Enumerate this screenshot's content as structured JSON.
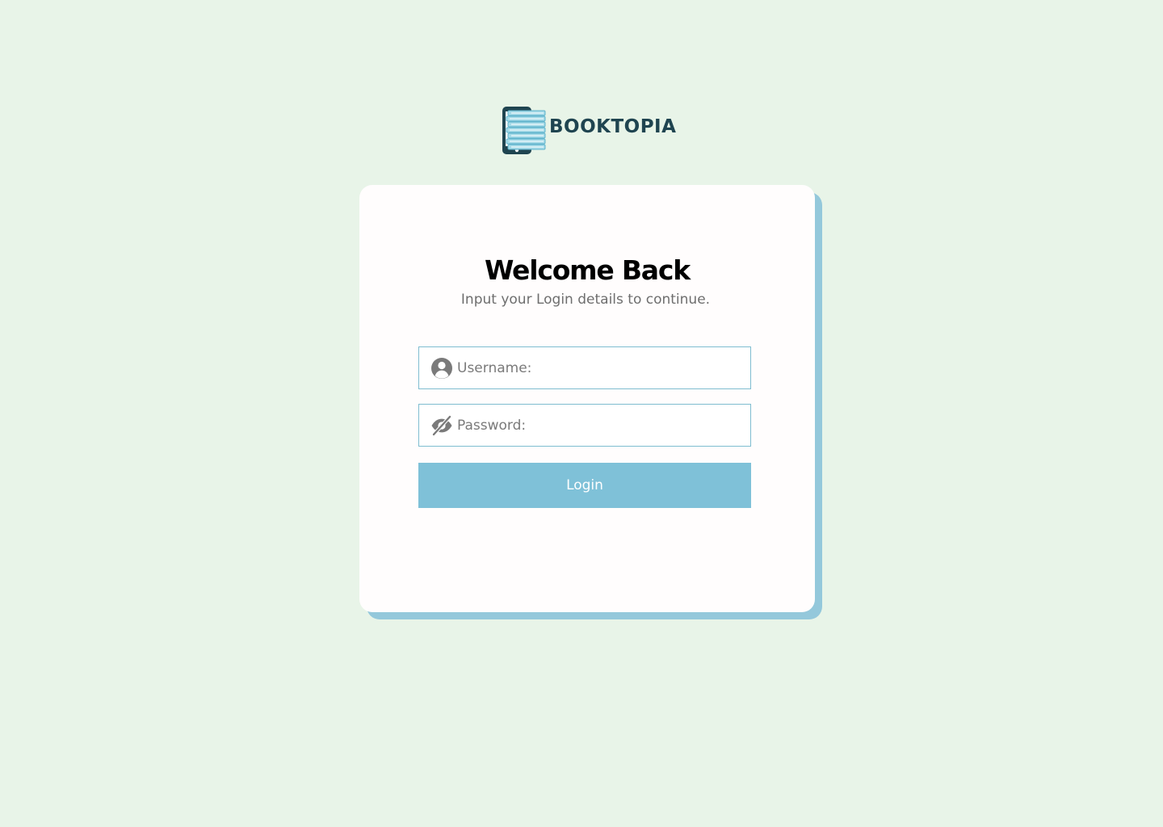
{
  "brand": {
    "name": "BOOKTOPIA",
    "logo_icon": "tablet-with-books-logo"
  },
  "login": {
    "title": "Welcome Back",
    "subtitle": "Input your Login details to continue.",
    "username": {
      "placeholder": "Username:",
      "value": "",
      "icon": "user-icon"
    },
    "password": {
      "placeholder": "Password:",
      "value": "",
      "icon": "eye-slash-icon"
    },
    "submit_label": "Login"
  },
  "colors": {
    "background": "#e8f4e8",
    "card": "#fffdfd",
    "card_shadow": "#94c8db",
    "accent": "#7fc1d8",
    "input_border": "#7fbdd0",
    "brand_text": "#1f4450",
    "subtitle_text": "#6e6e6e"
  }
}
